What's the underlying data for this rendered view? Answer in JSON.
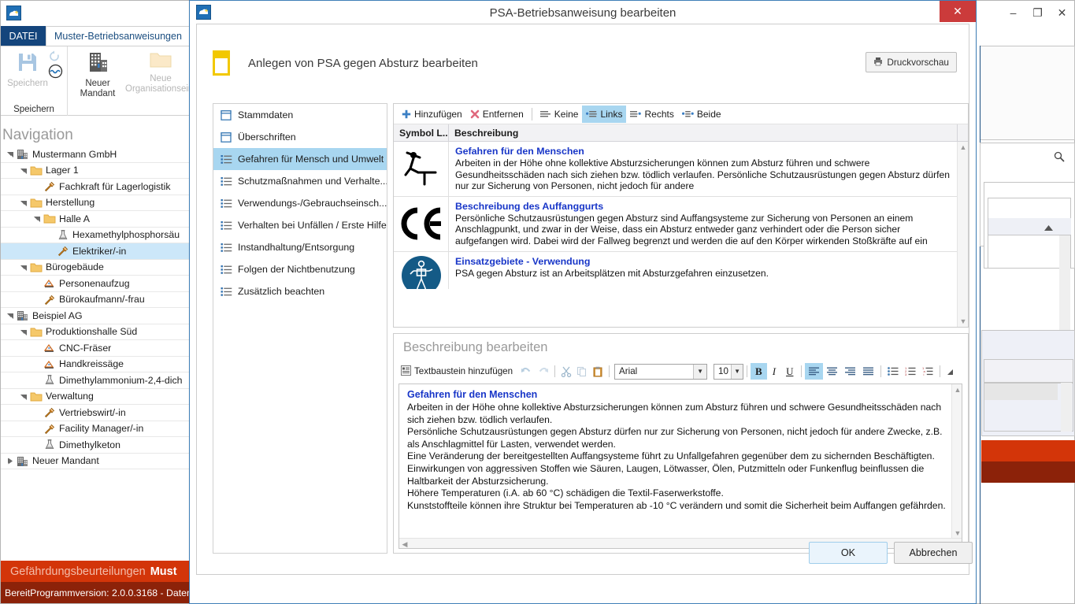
{
  "app": {
    "logo_icon": "app-logo-icon",
    "window_controls": {
      "minimize": "–",
      "maximize": "❐",
      "close": "✕"
    },
    "ribbon": {
      "tabs": [
        {
          "label": "DATEI",
          "name": "ribbon-tab-datei"
        },
        {
          "label": "Muster-Betriebsanweisungen",
          "name": "ribbon-tab-muster"
        }
      ],
      "groups": [
        {
          "label": "Speichern",
          "buttons": [
            {
              "label": "Speichern",
              "icon": "save-icon",
              "disabled": true
            },
            {
              "label": "",
              "icon": "refresh-icon",
              "disabled": true
            },
            {
              "label": "",
              "icon": "globe-icon",
              "disabled": false
            }
          ]
        },
        {
          "label": "",
          "buttons": [
            {
              "label": "Neuer\nMandant",
              "icon": "building-icon",
              "disabled": false
            },
            {
              "label": "Neue\nOrganisationseinh",
              "icon": "folder-icon",
              "disabled": true
            }
          ]
        }
      ],
      "btn_speichern": "Speichern",
      "btn_neuer_mandant_l1": "Neuer",
      "btn_neuer_mandant_l2": "Mandant",
      "btn_neue_org_l1": "Neue",
      "btn_neue_org_l2": "Organisationseinh",
      "group_label_speichern": "Speichern"
    },
    "navigation": {
      "title": "Navigation",
      "items": [
        {
          "label": "Mustermann GmbH",
          "depth": 0,
          "icon": "company-icon",
          "expander": "open",
          "selected": false
        },
        {
          "label": "Lager 1",
          "depth": 1,
          "icon": "folder-icon",
          "expander": "open",
          "selected": false
        },
        {
          "label": "Fachkraft für Lagerlogistik",
          "depth": 2,
          "icon": "tool-icon",
          "expander": "none",
          "selected": false
        },
        {
          "label": "Herstellung",
          "depth": 1,
          "icon": "folder-icon",
          "expander": "open",
          "selected": false
        },
        {
          "label": "Halle A",
          "depth": 2,
          "icon": "folder-icon",
          "expander": "open",
          "selected": false
        },
        {
          "label": "Hexamethylphosphorsäu",
          "depth": 3,
          "icon": "flask-icon",
          "expander": "none",
          "selected": false
        },
        {
          "label": "Elektriker/-in",
          "depth": 3,
          "icon": "tool-icon",
          "expander": "none",
          "selected": true
        },
        {
          "label": "Bürogebäude",
          "depth": 1,
          "icon": "folder-icon",
          "expander": "open",
          "selected": false
        },
        {
          "label": "Personenaufzug",
          "depth": 2,
          "icon": "machine-icon",
          "expander": "none",
          "selected": false
        },
        {
          "label": "Bürokaufmann/-frau",
          "depth": 2,
          "icon": "tool-icon",
          "expander": "none",
          "selected": false
        },
        {
          "label": "Beispiel AG",
          "depth": 0,
          "icon": "company-icon",
          "expander": "open",
          "selected": false
        },
        {
          "label": "Produktionshalle Süd",
          "depth": 1,
          "icon": "folder-icon",
          "expander": "open",
          "selected": false
        },
        {
          "label": "CNC-Fräser",
          "depth": 2,
          "icon": "machine-icon",
          "expander": "none",
          "selected": false
        },
        {
          "label": "Handkreissäge",
          "depth": 2,
          "icon": "machine-icon",
          "expander": "none",
          "selected": false
        },
        {
          "label": "Dimethylammonium-2,4-dich",
          "depth": 2,
          "icon": "flask-icon",
          "expander": "none",
          "selected": false
        },
        {
          "label": "Verwaltung",
          "depth": 1,
          "icon": "folder-icon",
          "expander": "open",
          "selected": false
        },
        {
          "label": "Vertriebswirt/-in",
          "depth": 2,
          "icon": "tool-icon",
          "expander": "none",
          "selected": false
        },
        {
          "label": "Facility Manager/-in",
          "depth": 2,
          "icon": "tool-icon",
          "expander": "none",
          "selected": false
        },
        {
          "label": "Dimethylketon",
          "depth": 2,
          "icon": "flask-icon",
          "expander": "none",
          "selected": false
        },
        {
          "label": "Neuer Mandant",
          "depth": 0,
          "icon": "company-icon",
          "expander": "closed",
          "selected": false
        }
      ]
    },
    "breadcrumb": {
      "dim_text": "Gefährdungsbeurteilungen",
      "strong_text": "Must"
    },
    "statusbar": {
      "state": "Bereit",
      "version": "Programmversion: 2.0.0.3168 - Daten"
    },
    "colors": {
      "breadcrumb_bg": "#d33509",
      "status_bg": "#8c2209",
      "file_tab_bg": "#14457c",
      "selection_bg": "#cce7f9"
    }
  },
  "dialog": {
    "title": "PSA-Betriebsanweisung bearbeiten",
    "icon": "app-logo-icon",
    "close_label": "✕",
    "header": {
      "title": "Anlegen von PSA gegen Absturz bearbeiten",
      "icon": "document-yellow-icon",
      "print_button": {
        "label": "Druckvorschau",
        "icon": "printer-icon"
      }
    },
    "section_list": [
      {
        "label": "Stammdaten",
        "icon": "form-icon",
        "selected": false
      },
      {
        "label": "Überschriften",
        "icon": "form-icon",
        "selected": false
      },
      {
        "label": "Gefahren für Mensch und Umwelt",
        "icon": "list-icon",
        "selected": true
      },
      {
        "label": "Schutzmaßnahmen und Verhalte...",
        "icon": "list-icon",
        "selected": false
      },
      {
        "label": "Verwendungs-/Gebrauchseinsch...",
        "icon": "list-icon",
        "selected": false
      },
      {
        "label": "Verhalten bei Unfällen / Erste Hilfe",
        "icon": "list-icon",
        "selected": false
      },
      {
        "label": "Instandhaltung/Entsorgung",
        "icon": "list-icon",
        "selected": false
      },
      {
        "label": "Folgen der Nichtbenutzung",
        "icon": "list-icon",
        "selected": false
      },
      {
        "label": "Zusätzlich beachten",
        "icon": "list-icon",
        "selected": false
      }
    ],
    "grid": {
      "toolbar": [
        {
          "label": "Hinzufügen",
          "icon": "plus-icon",
          "active": false,
          "name": "add-button"
        },
        {
          "label": "Entfernen",
          "icon": "remove-x-icon",
          "active": false,
          "name": "remove-button"
        },
        {
          "label": "Keine",
          "icon": "align-none-icon",
          "active": false,
          "name": "align-none-button"
        },
        {
          "label": "Links",
          "icon": "align-left-icon",
          "active": true,
          "name": "align-left-button"
        },
        {
          "label": "Rechts",
          "icon": "align-right-icon",
          "active": false,
          "name": "align-right-button"
        },
        {
          "label": "Beide",
          "icon": "align-both-icon",
          "active": false,
          "name": "align-both-button"
        }
      ],
      "columns": [
        "Symbol L...",
        "Beschreibung"
      ],
      "rows": [
        {
          "symbol": "fall-hazard-icon",
          "title": "Gefahren für den Menschen",
          "body": "Arbeiten in der Höhe ohne kollektive Absturzsicherungen können zum Absturz führen und schwere Gesundheitsschäden nach sich ziehen bzw. tödlich verlaufen.\nPersönliche Schutzausrüstungen gegen Absturz dürfen nur zur Sicherung von Personen, nicht jedoch für andere"
        },
        {
          "symbol": "ce-mark-icon",
          "title": "Beschreibung des Auffanggurts",
          "body": "Persönliche Schutzausrüstungen gegen Absturz sind Auffangsysteme zur Sicherung von Personen an einem Anschlagpunkt, und zwar in der Weise, dass ein Absturz entweder ganz verhindert oder die Person sicher aufgefangen wird. Dabei wird der Fallweg begrenzt und werden die auf den Körper wirkenden Stoßkräfte auf ein"
        },
        {
          "symbol": "harness-mandatory-icon",
          "title": "Einsatzgebiete - Verwendung",
          "body": "PSA gegen Absturz ist an Arbeitsplätzen mit Absturzgefahren einzusetzen."
        }
      ]
    },
    "editor": {
      "title": "Beschreibung bearbeiten",
      "toolbar": {
        "textbaustein_label": "Textbaustein hinzufügen",
        "textbaustein_icon": "textblock-icon",
        "undo_icon": "undo-icon",
        "redo_icon": "redo-icon",
        "cut_icon": "scissors-icon",
        "copy_icon": "copy-icon",
        "paste_icon": "paste-icon",
        "font_family": "Arial",
        "font_size": "10",
        "bold_label": "B",
        "italic_label": "I",
        "underline_label": "U",
        "align_left_icon": "align-left-icon",
        "align_center_icon": "align-center-icon",
        "align_right_icon": "align-right-icon",
        "align_justify_icon": "align-justify-icon",
        "bullet_list_icon": "bullet-list-icon",
        "number_list_icon": "numbered-list-icon",
        "multilevel_list_icon": "multilevel-list-icon",
        "overflow_icon": "overflow-arrow-icon",
        "bold_active": true,
        "align_left_active": true
      },
      "content": {
        "heading": "Gefahren für den Menschen",
        "paragraphs": [
          "Arbeiten in der Höhe ohne kollektive Absturzsicherungen können zum Absturz führen und schwere Gesundheitsschäden nach sich ziehen bzw. tödlich verlaufen.",
          "Persönliche Schutzausrüstungen gegen Absturz dürfen nur zur Sicherung von Personen, nicht jedoch für andere Zwecke, z.B. als Anschlagmittel für Lasten, verwendet werden.",
          "Eine Veränderung der bereitgestellten Auffangsysteme führt zu Unfallgefahren gegenüber dem zu sichernden Beschäftigten.",
          "Einwirkungen von aggressiven Stoffen wie Säuren, Laugen, Lötwasser, Ölen, Putzmitteln oder Funkenflug beinflussen die Haltbarkeit der Absturzsicherung.",
          "Höhere Temperaturen (i.A. ab 60 °C) schädigen die Textil-Faserwerkstoffe.",
          "Kunststoffteile können ihre Struktur bei Temperaturen  ab -10 °C verändern und somit die Sicherheit beim Auffangen gefährden."
        ]
      }
    },
    "footer": {
      "ok_label": "OK",
      "cancel_label": "Abbrechen"
    }
  }
}
